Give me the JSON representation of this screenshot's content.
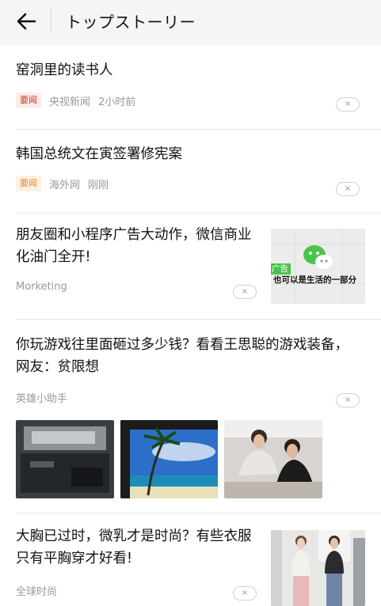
{
  "header": {
    "title": "トップストーリー"
  },
  "feed": [
    {
      "title": "窑洞里的读书人",
      "badge": "要闻",
      "source": "央视新闻",
      "time": "2小时前"
    },
    {
      "title": "韩国总统文在寅签署修宪案",
      "badge": "要闻",
      "source": "海外网",
      "time": "刚刚"
    },
    {
      "title_line1": "朋友圈和小程序广告大动作，微信商业",
      "title_line2": "化油门全开!",
      "source": "Morketing",
      "thumb_tag": "广告",
      "thumb_caption": "也可以是生活的一部分"
    },
    {
      "title_line1": "你玩游戏往里面砸过多少钱？看看王思聪的游戏装备，",
      "title_line2": "网友：贫限想",
      "source": "英雄小助手"
    },
    {
      "title_line1": "大胸已过时，微乳才是时尚？有些衣服",
      "title_line2": "只有平胸穿才好看!",
      "source": "全球时尚"
    }
  ],
  "close_glyph": "×"
}
